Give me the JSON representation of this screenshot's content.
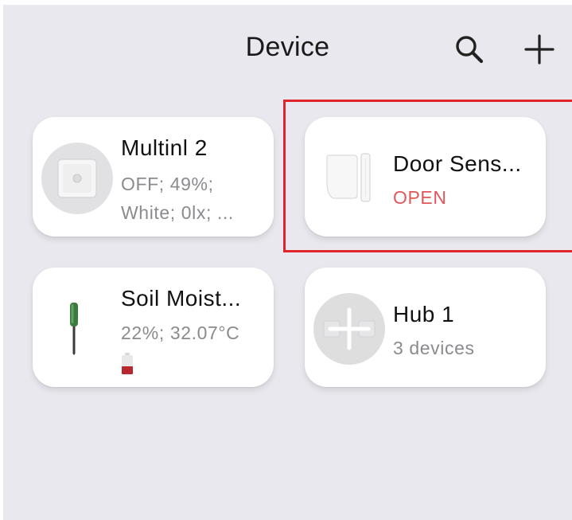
{
  "header": {
    "title": "Device"
  },
  "devices": [
    {
      "name": "Multinl 2",
      "status_line1": "OFF; 49%;",
      "status_line2": "White; 0lx; ...",
      "icon": "smart-plug-icon"
    },
    {
      "name": "Door Sens...",
      "status_line1": "OPEN",
      "status_color": "#e0575b",
      "icon": "door-sensor-icon"
    },
    {
      "name": "Soil Moist...",
      "status_line1": "22%; 32.07°C",
      "icon": "soil-probe-icon",
      "battery_icon": "battery-low-icon"
    },
    {
      "name": "Hub 1",
      "status_line1": "3 devices",
      "icon": "hub-icon"
    }
  ],
  "colors": {
    "background": "#e9e8ee",
    "card": "#ffffff",
    "highlight_border": "#e0242b",
    "alert_text": "#e0575b",
    "battery_low": "#b8292f"
  }
}
